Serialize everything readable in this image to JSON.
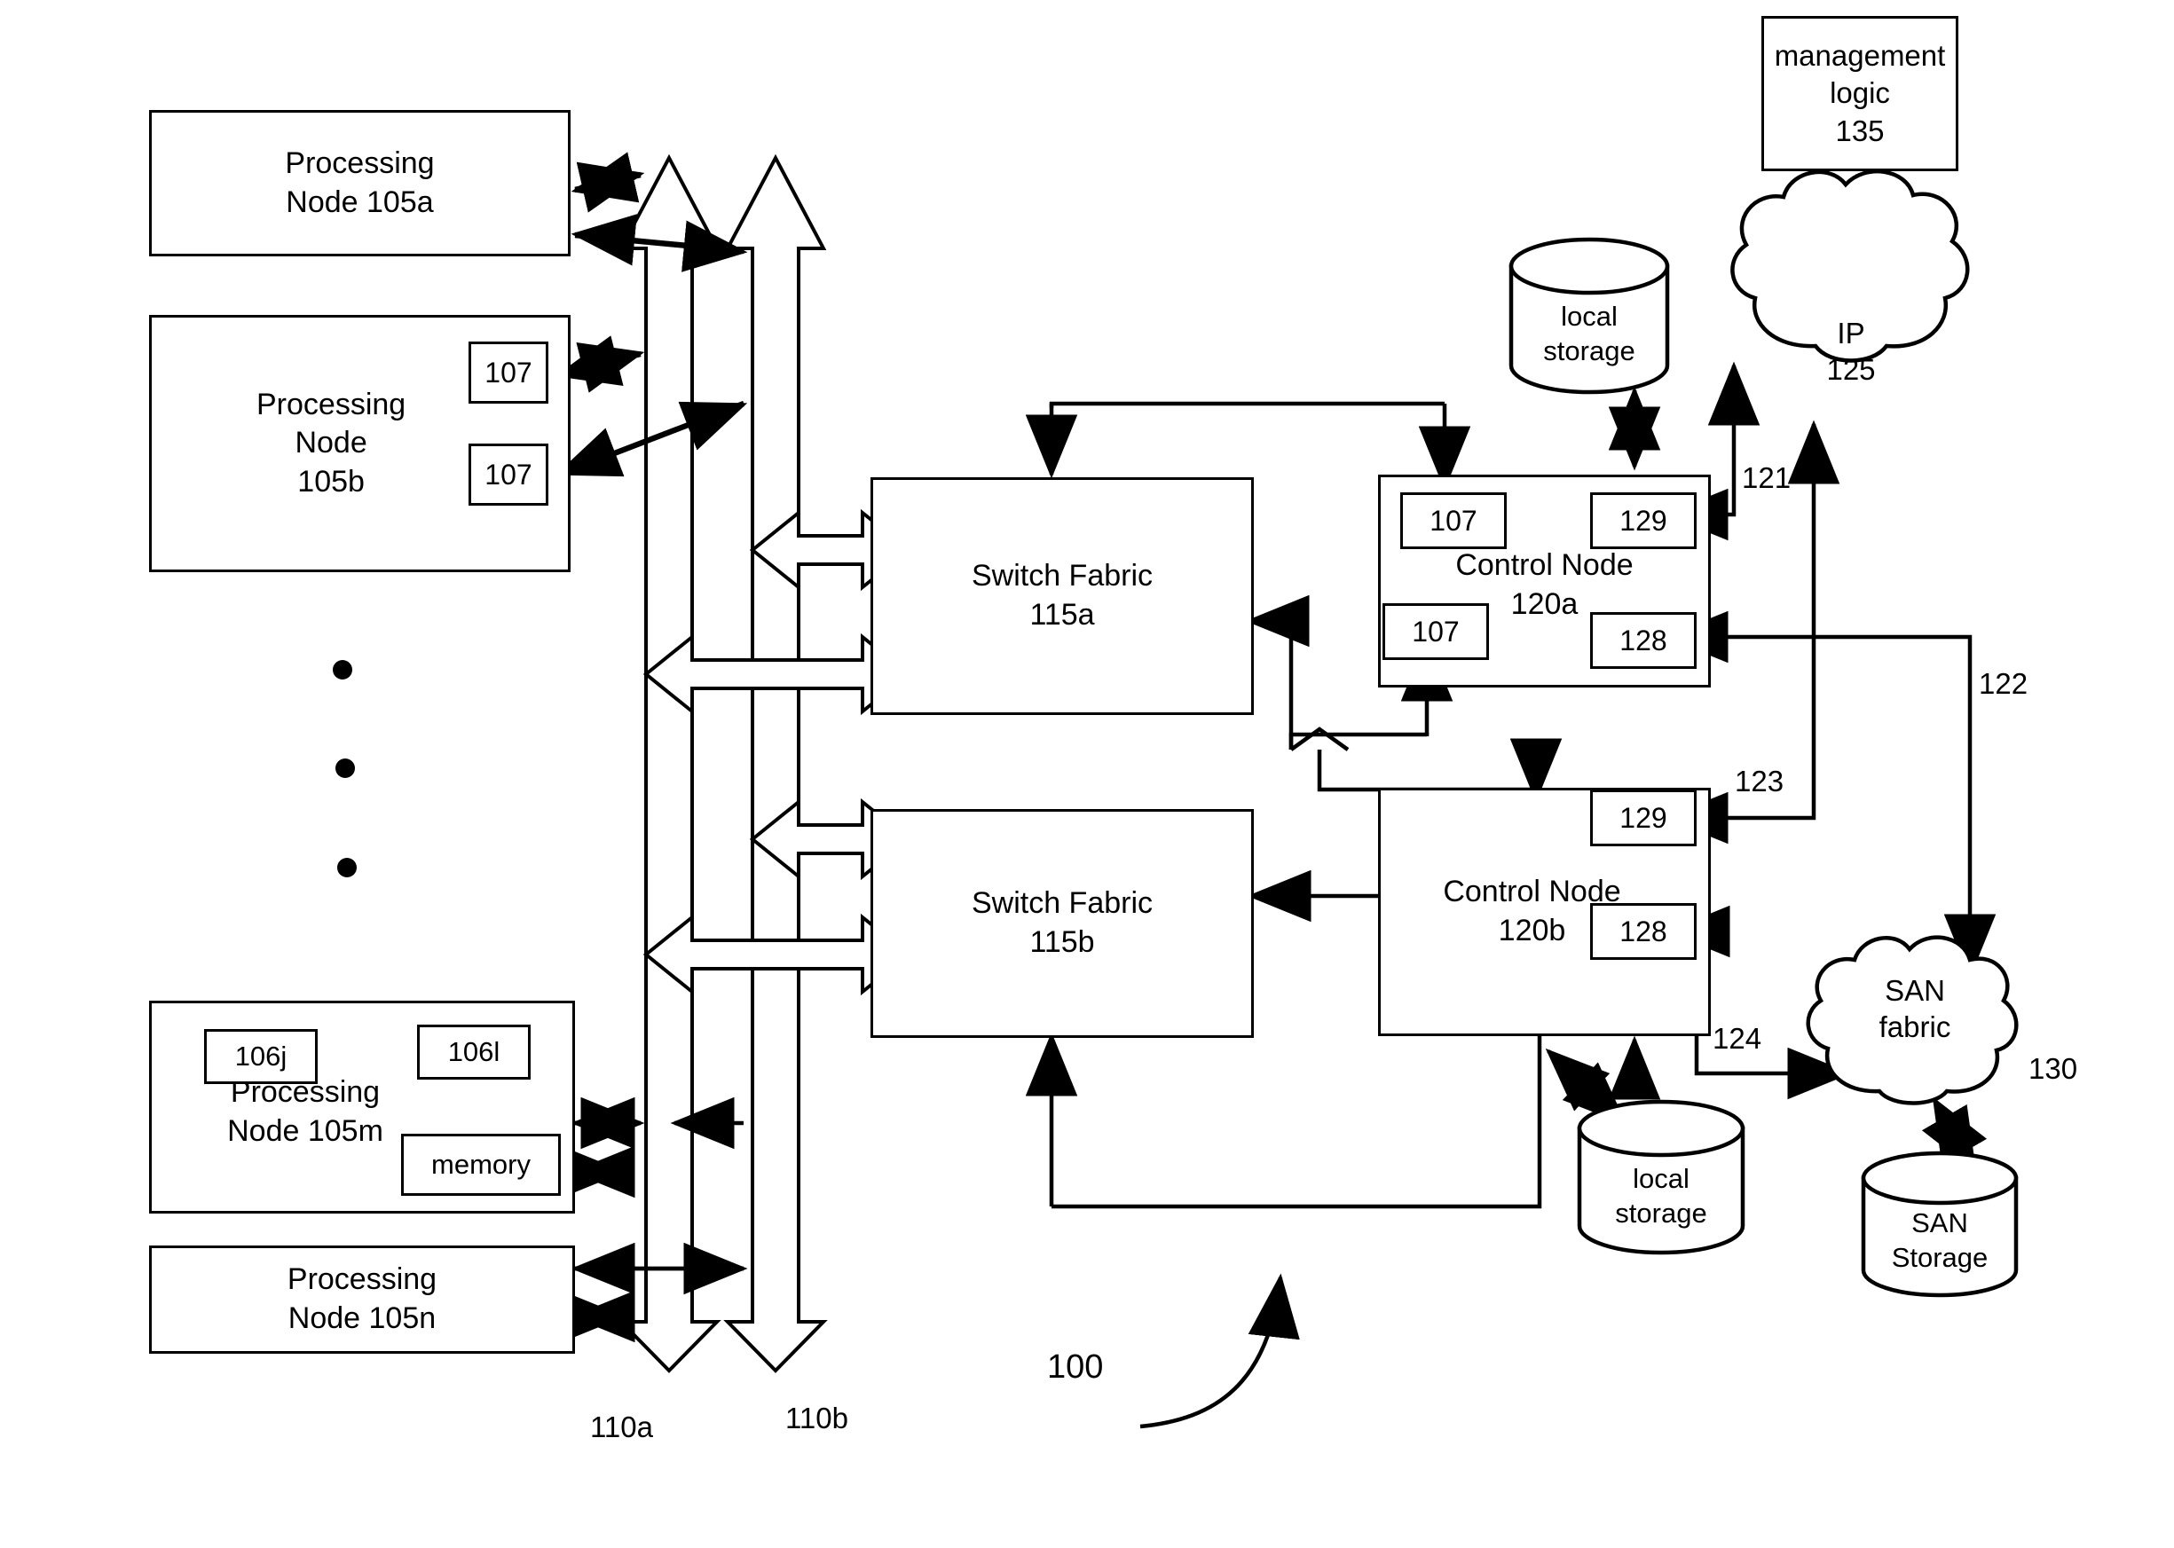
{
  "figure": {
    "id": "100",
    "type": "patent-block-diagram"
  },
  "processing_nodes": [
    {
      "label": "Processing\nNode 105a",
      "ref": "105a"
    },
    {
      "label": "Processing\nNode\n105b",
      "ref": "105b"
    },
    {
      "label": "Processing\nNode 105m",
      "ref": "105m"
    },
    {
      "label": "Processing\nNode 105n",
      "ref": "105n"
    }
  ],
  "node_105b_adapters": [
    {
      "label": "107"
    },
    {
      "label": "107"
    }
  ],
  "node_105m_parts": [
    {
      "label": "106j"
    },
    {
      "label": "106l"
    },
    {
      "label": "memory"
    }
  ],
  "buses": [
    {
      "label": "110a"
    },
    {
      "label": "110b"
    }
  ],
  "switch_fabrics": [
    {
      "label": "Switch Fabric\n115a",
      "ref": "115a"
    },
    {
      "label": "Switch Fabric\n115b",
      "ref": "115b"
    }
  ],
  "control_nodes": [
    {
      "label": "Control Node\n120a",
      "ref": "120a",
      "parts": [
        {
          "label": "107"
        },
        {
          "label": "129"
        },
        {
          "label": "107"
        },
        {
          "label": "128"
        }
      ]
    },
    {
      "label": "Control Node\n120b",
      "ref": "120b",
      "parts": [
        {
          "label": "129"
        },
        {
          "label": "128"
        }
      ]
    }
  ],
  "storage": [
    {
      "label": "local\nstorage",
      "position": "top"
    },
    {
      "label": "local\nstorage",
      "position": "bottom"
    },
    {
      "label": "SAN\nStorage",
      "position": "san"
    }
  ],
  "clouds": [
    {
      "label": "IP\n125",
      "ref": "125"
    },
    {
      "label": "SAN\nfabric",
      "ref": "130"
    }
  ],
  "management": {
    "label": "management\nlogic\n135",
    "ref": "135"
  },
  "link_labels": [
    {
      "label": "121"
    },
    {
      "label": "122"
    },
    {
      "label": "123"
    },
    {
      "label": "124"
    },
    {
      "label": "130"
    },
    {
      "label": "100"
    }
  ],
  "colors": {
    "line": "#000000",
    "background": "#ffffff"
  }
}
